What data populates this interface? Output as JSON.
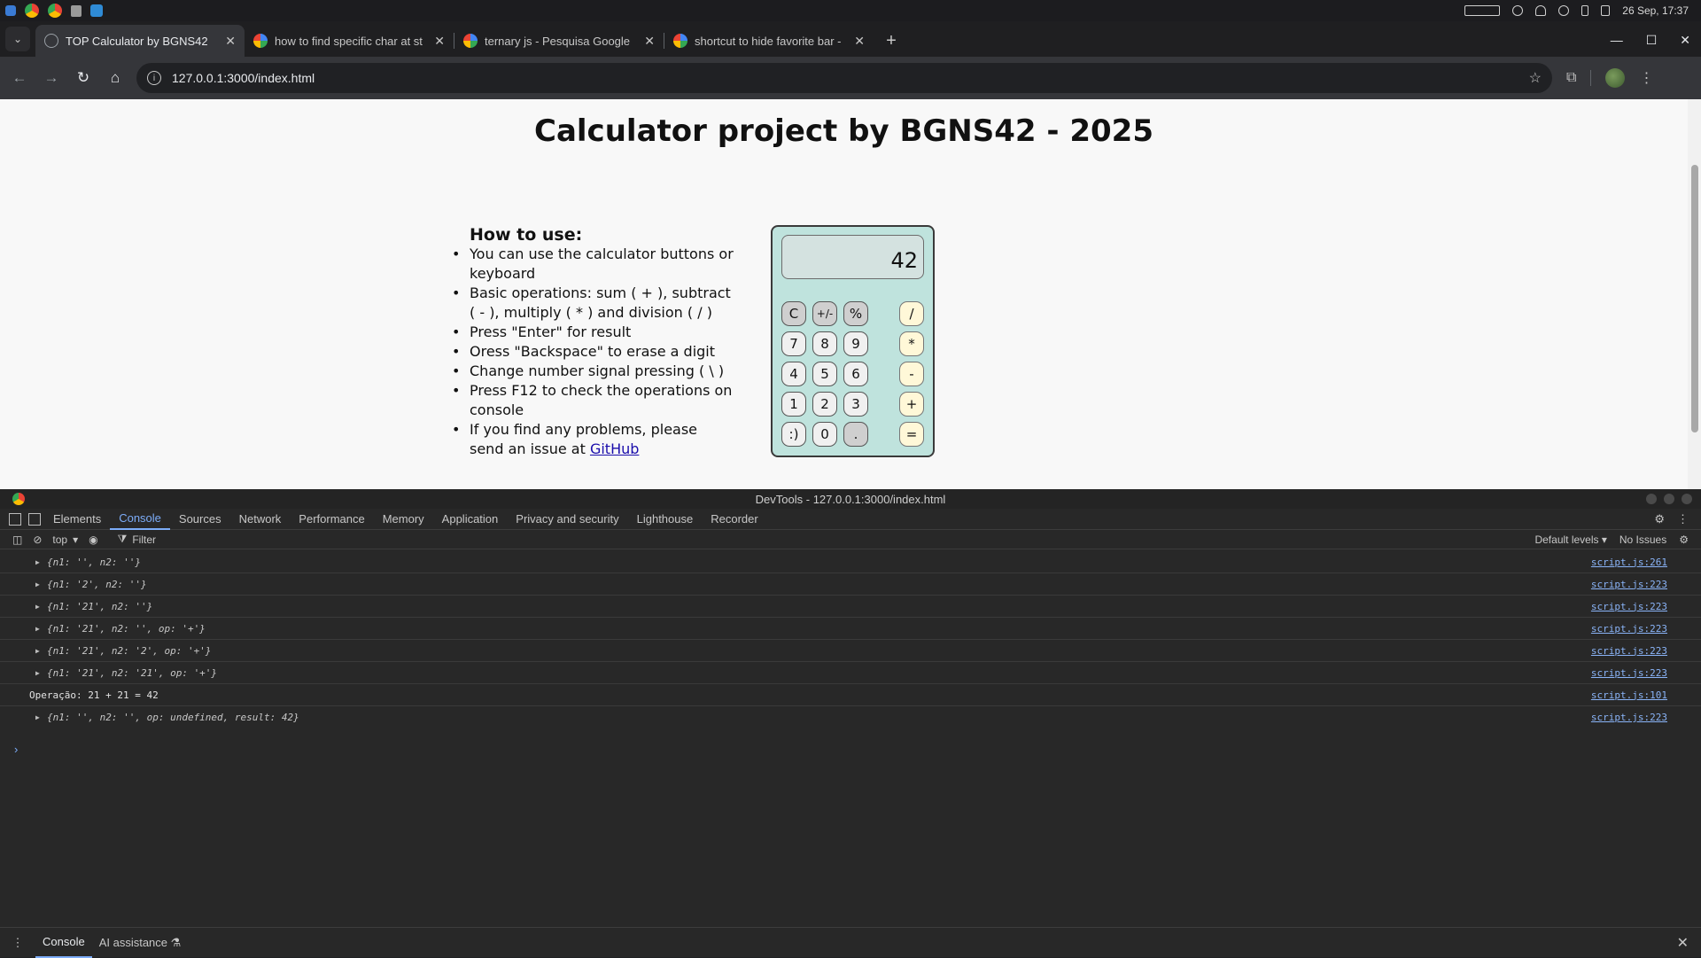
{
  "os": {
    "datetime": "26 Sep, 17:37"
  },
  "tabs": [
    {
      "title": "TOP Calculator by BGNS42",
      "active": true
    },
    {
      "title": "how to find specific char at st",
      "active": false
    },
    {
      "title": "ternary js - Pesquisa Google",
      "active": false
    },
    {
      "title": "shortcut to hide favorite bar -",
      "active": false
    }
  ],
  "address": {
    "url": "127.0.0.1:3000/index.html"
  },
  "page": {
    "title": "Calculator project by BGNS42 - 2025",
    "howto_heading": "How to use:",
    "items": [
      "You can use the calculator buttons or keyboard",
      "Basic operations: sum ( + ), subtract ( - ), multiply ( * ) and division ( / )",
      "Press \"Enter\" for result",
      "Oress \"Backspace\" to erase a digit",
      "Change number signal pressing ( \\ )",
      "Press F12 to check the operations on console"
    ],
    "issue_text": "If you find any problems, please send an issue at ",
    "issue_link": "GitHub"
  },
  "calculator": {
    "display": "42",
    "keys": {
      "clear": "C",
      "sign": "+/-",
      "percent": "%",
      "divide": "/",
      "k7": "7",
      "k8": "8",
      "k9": "9",
      "multiply": "*",
      "k4": "4",
      "k5": "5",
      "k6": "6",
      "subtract": "-",
      "k1": "1",
      "k2": "2",
      "k3": "3",
      "add": "+",
      "smile": ":)",
      "k0": "0",
      "dot": ".",
      "equals": "="
    }
  },
  "devtools": {
    "title": "DevTools - 127.0.0.1:3000/index.html",
    "tabs": [
      "Elements",
      "Console",
      "Sources",
      "Network",
      "Performance",
      "Memory",
      "Application",
      "Privacy and security",
      "Lighthouse",
      "Recorder"
    ],
    "context": "top",
    "filter_placeholder": "Filter",
    "levels": "Default levels",
    "issues": "No Issues",
    "logs": [
      {
        "text": "{n1: '', n2: ''}",
        "src": "script.js:261",
        "expandable": true
      },
      {
        "text": "{n1: '2', n2: ''}",
        "src": "script.js:223",
        "expandable": true
      },
      {
        "text": "{n1: '21', n2: ''}",
        "src": "script.js:223",
        "expandable": true
      },
      {
        "text": "{n1: '21', n2: '', op: '+'}",
        "src": "script.js:223",
        "expandable": true
      },
      {
        "text": "{n1: '21', n2: '2', op: '+'}",
        "src": "script.js:223",
        "expandable": true
      },
      {
        "text": "{n1: '21', n2: '21', op: '+'}",
        "src": "script.js:223",
        "expandable": true
      },
      {
        "text": "Operação: 21 + 21 = 42",
        "src": "script.js:101",
        "expandable": false
      },
      {
        "text": "{n1: '', n2: '', op: undefined, result: 42}",
        "src": "script.js:223",
        "expandable": true
      }
    ],
    "drawer": {
      "console": "Console",
      "ai": "AI assistance"
    }
  }
}
